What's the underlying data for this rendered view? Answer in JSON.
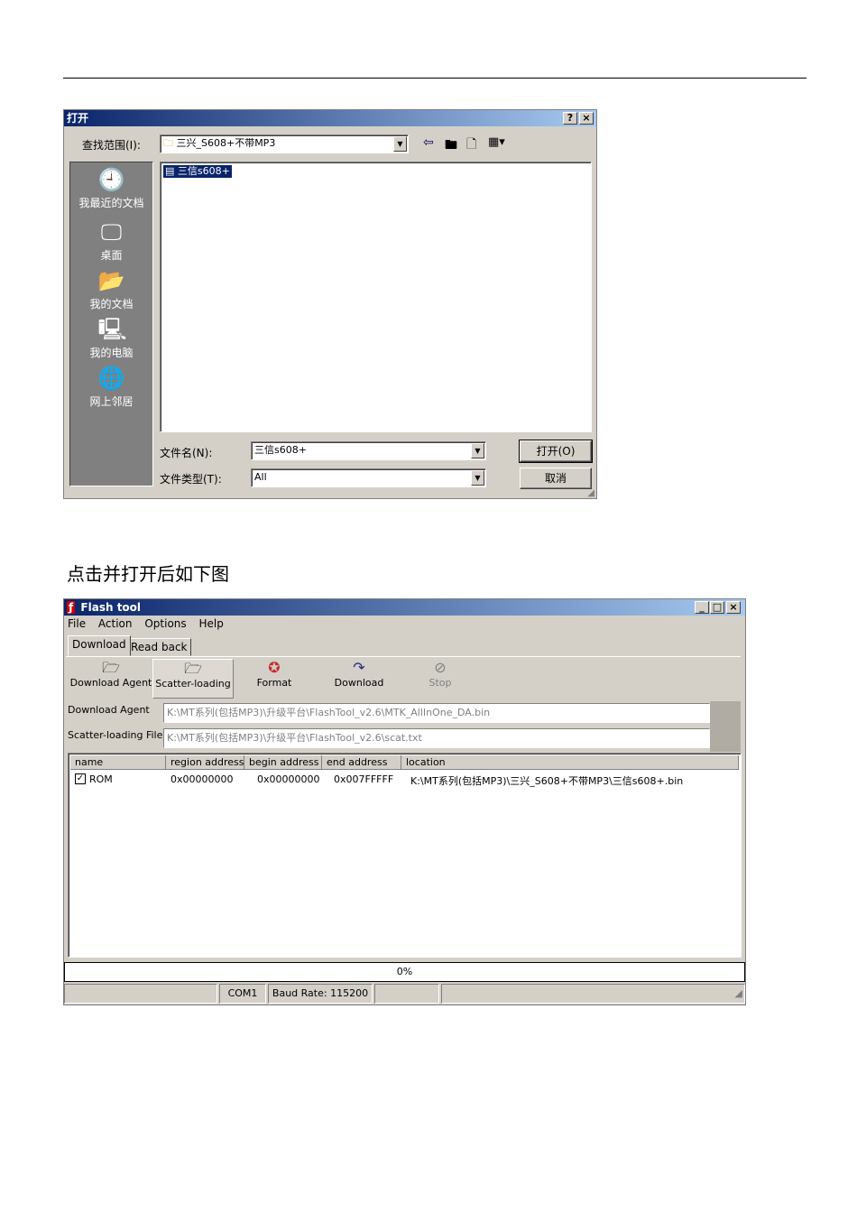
{
  "open_dialog": {
    "title": "打开",
    "help_btn": "?",
    "close_btn": "×",
    "look_in_label": "查找范围(I):",
    "look_in_value": "三兴_S608+不带MP3",
    "sidebar": [
      {
        "label": "我最近的文档",
        "icon": "recent-documents-icon"
      },
      {
        "label": "桌面",
        "icon": "desktop-icon"
      },
      {
        "label": "我的文档",
        "icon": "my-documents-icon"
      },
      {
        "label": "我的电脑",
        "icon": "my-computer-icon"
      },
      {
        "label": "网上邻居",
        "icon": "network-places-icon"
      }
    ],
    "files": [
      {
        "name": "三信s608+"
      }
    ],
    "filename_label": "文件名(N):",
    "filename_value": "三信s608+",
    "filetype_label": "文件类型(T):",
    "filetype_value": "All",
    "open_button": "打开(O)",
    "cancel_button": "取消"
  },
  "caption": "点击并打开后如下图",
  "flash_tool": {
    "title": "Flash tool",
    "menu": [
      "File",
      "Action",
      "Options",
      "Help"
    ],
    "tabs": [
      "Download",
      "Read back"
    ],
    "toolbar": [
      {
        "label": "Download Agent",
        "icon": "folder-open-icon"
      },
      {
        "label": "Scatter-loading",
        "icon": "folder-open-icon"
      },
      {
        "label": "Format",
        "icon": "format-icon"
      },
      {
        "label": "Download",
        "icon": "download-icon"
      },
      {
        "label": "Stop",
        "icon": "stop-icon"
      }
    ],
    "download_agent_label": "Download Agent",
    "download_agent_path": "K:\\MT系列(包括MP3)\\升级平台\\FlashTool_v2.6\\MTK_AllInOne_DA.bin",
    "scatter_label": "Scatter-loading File",
    "scatter_path": "K:\\MT系列(包括MP3)\\升级平台\\FlashTool_v2.6\\scat.txt",
    "columns": [
      "name",
      "region address",
      "begin address",
      "end address",
      "location"
    ],
    "rows": [
      {
        "checked": true,
        "name": "ROM",
        "region": "0x00000000",
        "begin": "0x00000000",
        "end": "0x007FFFFF",
        "location": "K:\\MT系列(包括MP3)\\三兴_S608+不带MP3\\三信s608+.bin"
      }
    ],
    "progress_text": "0%",
    "progress": 0,
    "status": {
      "port": "COM1",
      "baud": "Baud Rate: 115200"
    }
  }
}
